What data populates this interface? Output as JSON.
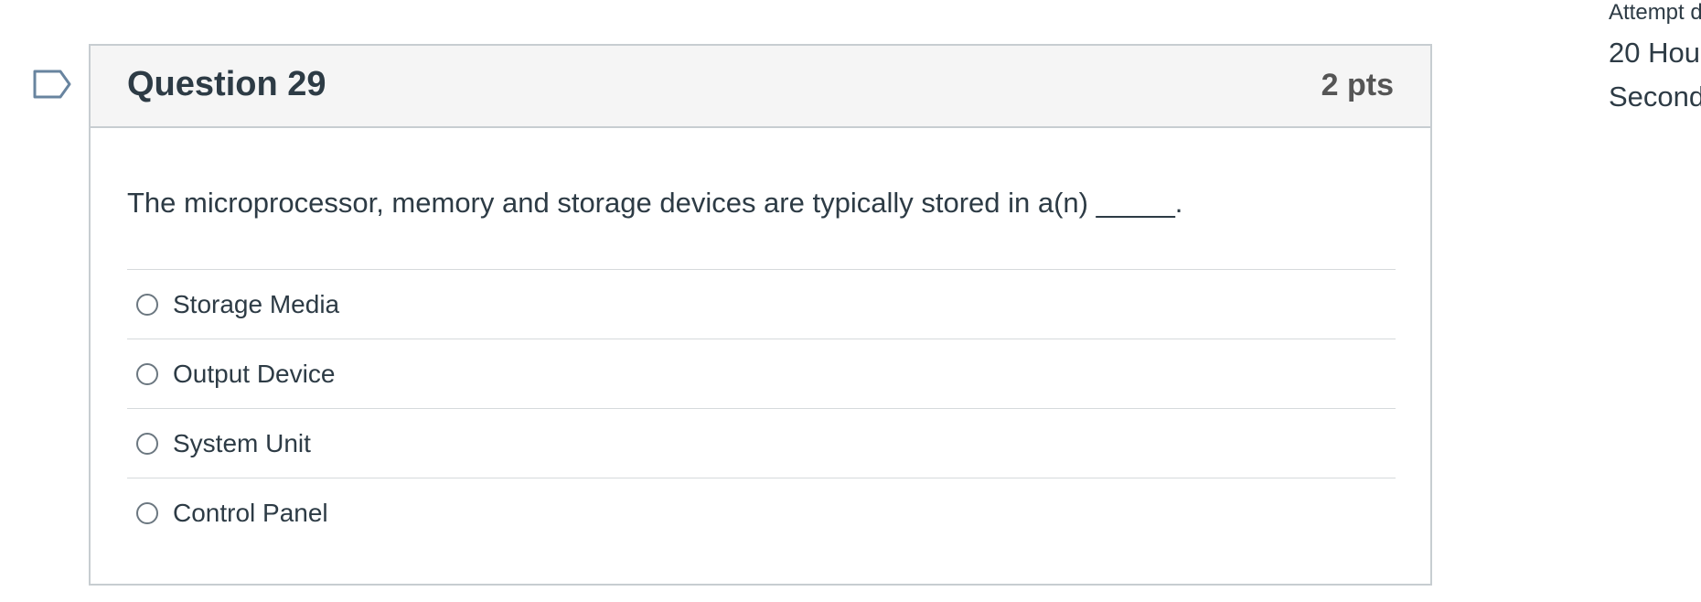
{
  "question": {
    "title": "Question 29",
    "points": "2 pts",
    "text": "The microprocessor, memory and storage devices are typically stored in a(n) _____.",
    "answers": [
      {
        "label": "Storage Media",
        "selected": false
      },
      {
        "label": "Output Device",
        "selected": false
      },
      {
        "label": "System Unit",
        "selected": false
      },
      {
        "label": "Control Panel",
        "selected": false
      }
    ]
  },
  "sidebar": {
    "attempt_label": "Attempt d",
    "timer_line1": "20 Hou",
    "timer_line2": "Second"
  },
  "icons": {
    "flag": "flag-outline-icon"
  },
  "colors": {
    "text": "#2d3b45",
    "border": "#c7cdd1",
    "header_bg": "#f5f5f5",
    "flag_stroke": "#68849f"
  }
}
